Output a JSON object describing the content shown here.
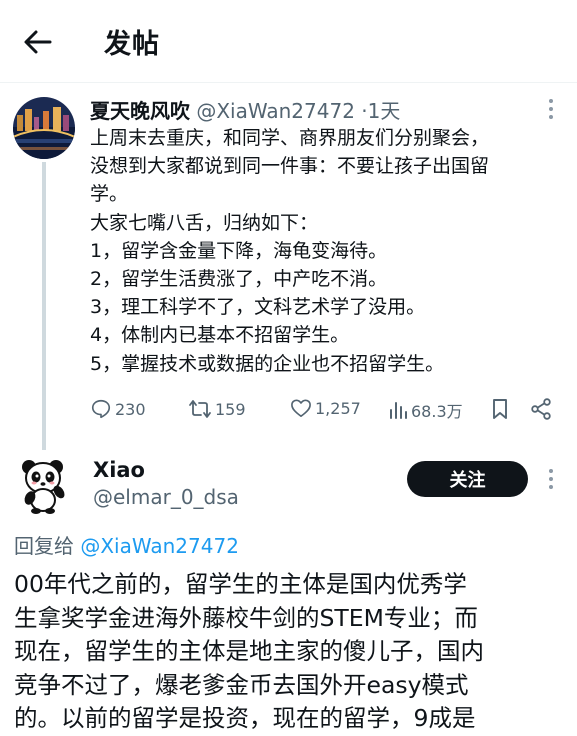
{
  "header": {
    "title": "发帖"
  },
  "post1": {
    "display_name": "夏天晚风吹",
    "handle": "@XiaWan27472",
    "separator": "·",
    "time": "1天",
    "lines": [
      "上周末去重庆，和同学、商界朋友们分别聚会，",
      "没想到大家都说到同一件事：不要让孩子出国留",
      "学。",
      "大家七嘴八舌，归纳如下：",
      "1，留学含金量下降，海龟变海待。",
      "2，留学生活费涨了，中产吃不消。",
      "3，理工科学不了，文科艺术学了没用。",
      "4，体制内已基本不招留学生。",
      "5，掌握技术或数据的企业也不招留学生。"
    ],
    "stats": {
      "replies": "230",
      "reposts": "159",
      "likes": "1,257",
      "views": "68.3万"
    }
  },
  "post2": {
    "display_name": "Xiao",
    "handle": "@elmar_0_dsa",
    "follow_label": "关注",
    "reply_prefix": "回复给",
    "reply_handle": "@XiaWan27472",
    "lines": [
      "00年代之前的，留学生的主体是国内优秀学",
      "生拿奖学金进海外藤校牛剑的STEM专业；而",
      "现在，留学生的主体是地主家的傻儿子，国内",
      "竞争不过了，爆老爹金币去国外开easy模式",
      "的。以前的留学是投资，现在的留学，9成是"
    ]
  },
  "icons": [
    "back-arrow-icon",
    "more-icon",
    "reply-icon",
    "repost-icon",
    "like-icon",
    "views-icon",
    "bookmark-icon",
    "share-icon",
    "panda-avatar-icon"
  ],
  "colors": {
    "text": "#0f1419",
    "secondary": "#536471",
    "accent": "#1d9bf0",
    "follow_bg": "#0f1419"
  }
}
